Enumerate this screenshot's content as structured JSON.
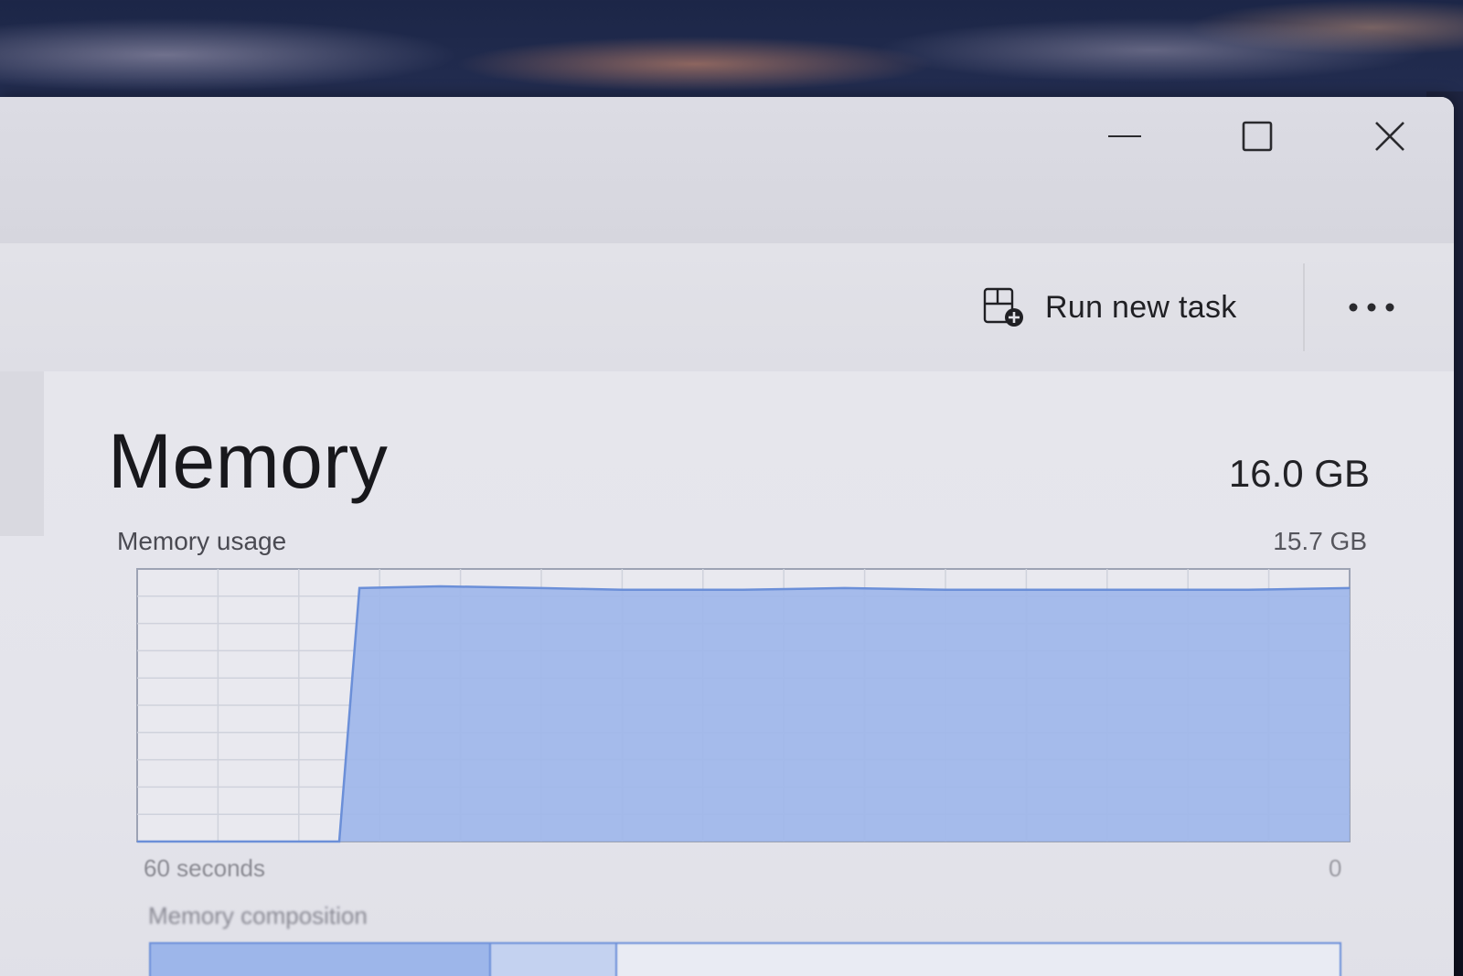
{
  "window": {
    "controls": {
      "minimize_icon": "minimize-icon",
      "maximize_icon": "maximize-icon",
      "close_icon": "close-icon"
    }
  },
  "toolbar": {
    "run_new_task_label": "Run new task",
    "run_new_task_icon": "run-task-icon",
    "more_icon": "more-options-icon"
  },
  "memory": {
    "title": "Memory",
    "total": "16.0 GB",
    "usage_label": "Memory usage",
    "usage_max": "15.7 GB",
    "axis_left": "60 seconds",
    "axis_right": "0",
    "composition_label": "Memory composition"
  },
  "colors": {
    "accent": "#6b8fd8",
    "fill": "#9db6ea"
  },
  "chart_data": {
    "type": "area",
    "x": [
      60,
      50,
      49,
      45,
      40,
      36,
      30,
      25,
      20,
      15,
      10,
      5,
      0
    ],
    "values": [
      0,
      0,
      14.6,
      14.7,
      14.6,
      14.5,
      14.5,
      14.6,
      14.5,
      14.5,
      14.5,
      14.5,
      14.6
    ],
    "xlabel": "60 seconds",
    "ylabel": "Memory usage",
    "ylim": [
      0,
      15.7
    ],
    "xlim": [
      60,
      0
    ],
    "grid": true
  }
}
